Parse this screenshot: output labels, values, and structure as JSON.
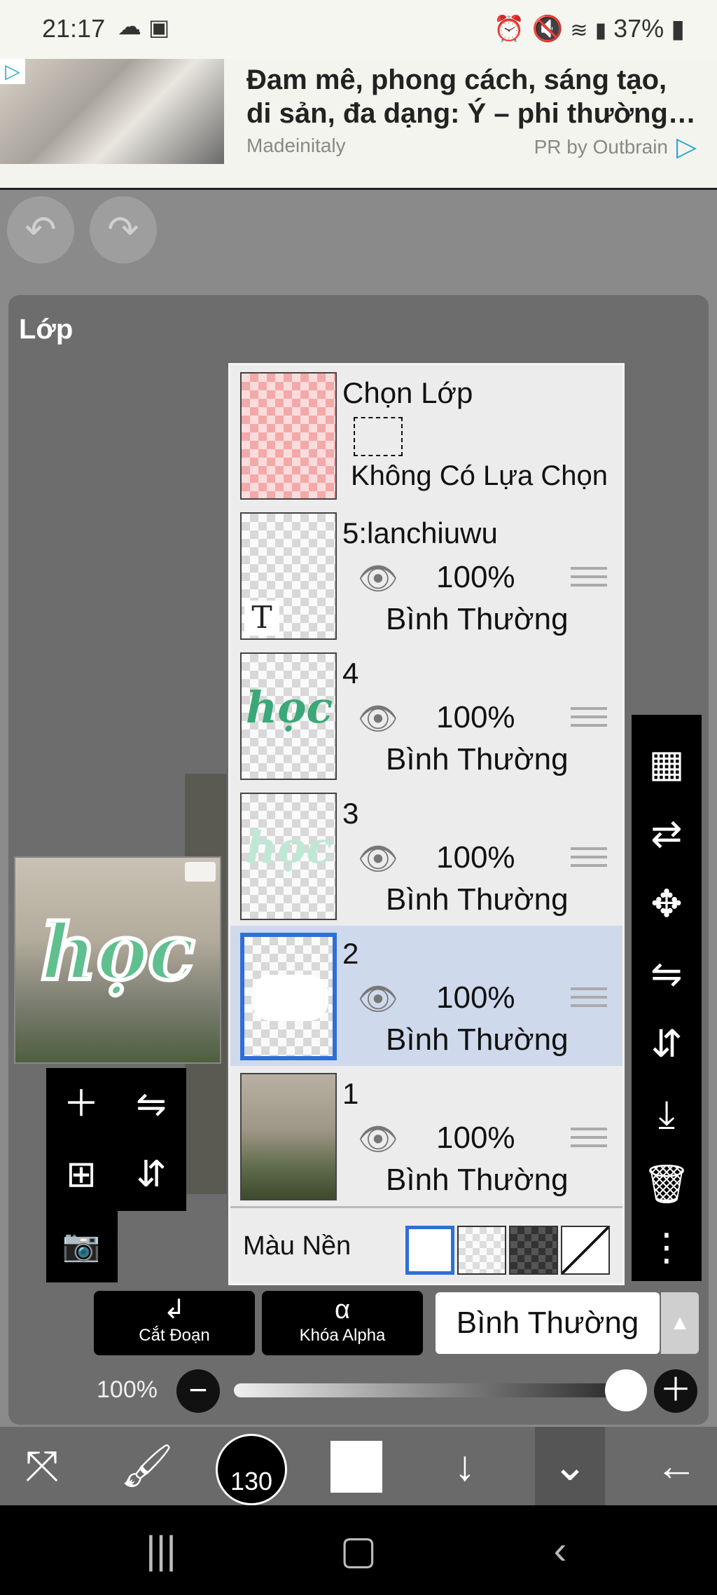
{
  "status": {
    "time": "21:17",
    "battery": "37%",
    "icons": [
      "cloud-icon",
      "gallery-icon",
      "alarm-icon",
      "mute-icon",
      "wifi-icon",
      "signal-icon",
      "battery-icon"
    ]
  },
  "ad": {
    "headline": "Đam mê, phong cách, sáng tạo,\ndi sản, đa dạng: Ý – phi thường…",
    "source": "Madeinitaly",
    "pr": "PR by Outbrain"
  },
  "panel": {
    "title": "Lớp"
  },
  "selection_layer": {
    "title": "Chọn Lớp",
    "status": "Không Có Lựa Chọn"
  },
  "layers": [
    {
      "name": "5:lanchiuwu",
      "opacity": "100%",
      "blend": "Bình Thường"
    },
    {
      "name": "4",
      "opacity": "100%",
      "blend": "Bình Thường"
    },
    {
      "name": "3",
      "opacity": "100%",
      "blend": "Bình Thường"
    },
    {
      "name": "2",
      "opacity": "100%",
      "blend": "Bình Thường",
      "selected": true
    },
    {
      "name": "1",
      "opacity": "100%",
      "blend": "Bình Thường"
    }
  ],
  "background": {
    "label": "Màu Nền"
  },
  "thumb_text": {
    "text_glyph": "T",
    "word": "học"
  },
  "actions": {
    "clip": "Cắt Đoạn",
    "alpha_lock": "Khóa Alpha",
    "alpha_glyph": "α",
    "blend_mode": "Bình Thường"
  },
  "opacity_slider": {
    "label": "100%",
    "value": 1.0
  },
  "brush_size": "130",
  "colors": {
    "selected_border": "#2f6fd6",
    "selected_row": "#cfd9ec",
    "green_text": "#5fbf8f"
  }
}
